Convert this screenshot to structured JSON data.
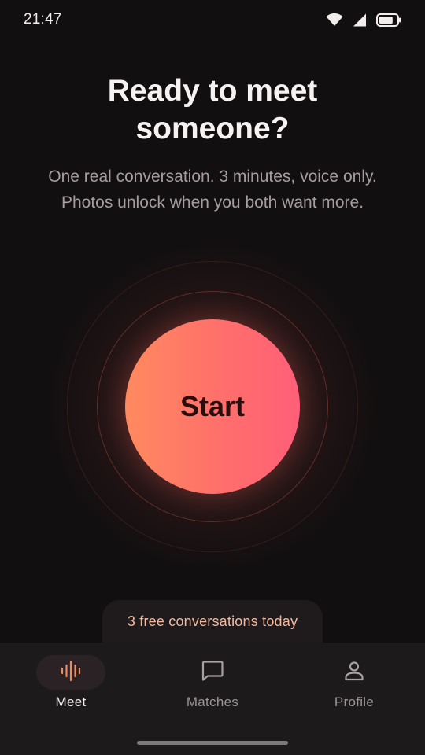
{
  "status_bar": {
    "time": "21:47",
    "icons": [
      "wifi-icon",
      "cellular-signal-icon",
      "battery-icon"
    ],
    "battery_level": 0.8
  },
  "header": {
    "title_line1": "Ready to meet",
    "title_line2": "someone?",
    "subtitle_line1": "One real conversation. 3 minutes, voice only.",
    "subtitle_line2": "Photos unlock when you both want more."
  },
  "start": {
    "label": "Start"
  },
  "free_pill": {
    "text": "3 free conversations today"
  },
  "bottom_nav": {
    "items": [
      {
        "label": "Meet",
        "icon": "soundwave-icon",
        "active": true
      },
      {
        "label": "Matches",
        "icon": "chat-bubble-icon",
        "active": false
      },
      {
        "label": "Profile",
        "icon": "person-icon",
        "active": false
      }
    ]
  },
  "colors": {
    "background": "#120f10",
    "accent_start": "#ff8a5f",
    "accent_end": "#ff5f78",
    "pill_text": "#f3b9a0",
    "nav_background": "#1d1a1c"
  }
}
